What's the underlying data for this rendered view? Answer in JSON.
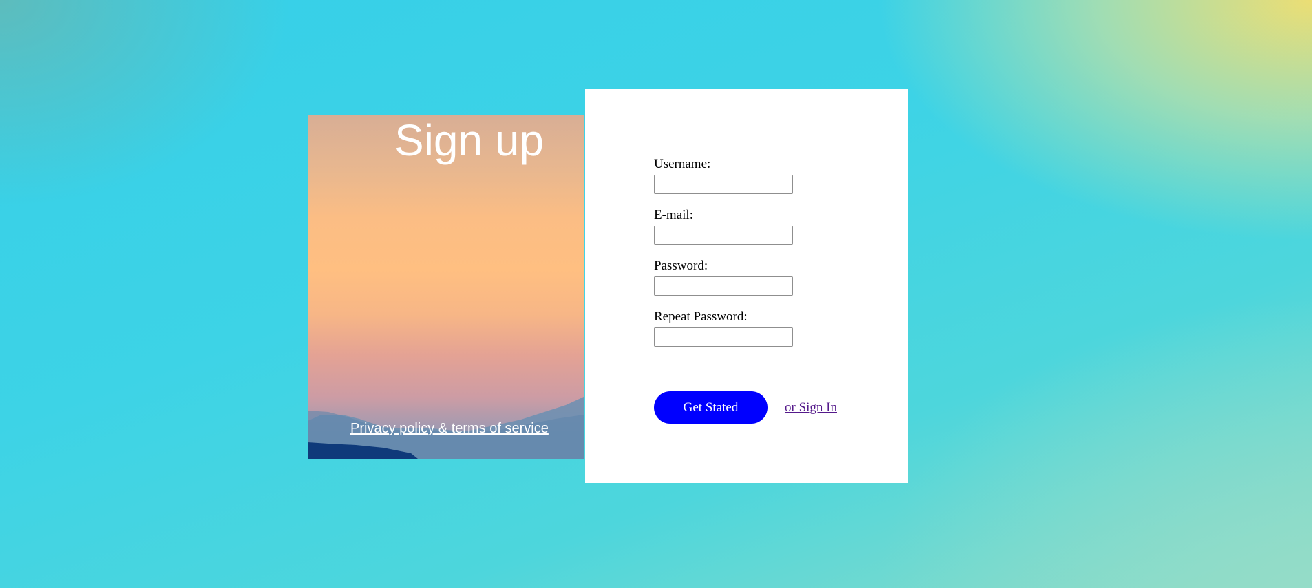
{
  "hero": {
    "title": "Sign up",
    "privacy_link": "Privacy policy & terms of service"
  },
  "form": {
    "fields": [
      {
        "label": "Username:",
        "value": "",
        "placeholder": ""
      },
      {
        "label": "E-mail:",
        "value": "",
        "placeholder": ""
      },
      {
        "label": "Password:",
        "value": "",
        "placeholder": ""
      },
      {
        "label": "Repeat Password:",
        "value": "",
        "placeholder": ""
      }
    ],
    "submit_label": "Get Stated",
    "signin_link": "or Sign In"
  },
  "colors": {
    "button": "#0000ff",
    "visited_link": "#551a8b",
    "panel": "#ffffff"
  }
}
